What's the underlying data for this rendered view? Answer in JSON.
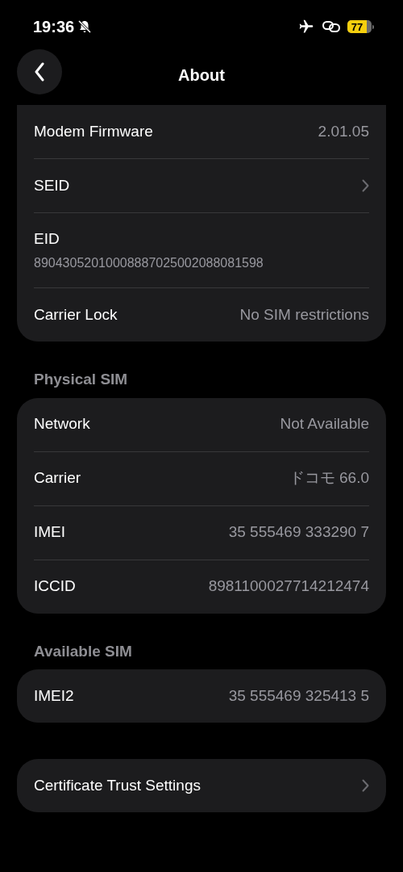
{
  "status_bar": {
    "time": "19:36",
    "battery": "77"
  },
  "nav": {
    "title": "About"
  },
  "sections": [
    {
      "rows": [
        {
          "kind": "value",
          "label": "Modem Firmware",
          "value": "2.01.05"
        },
        {
          "kind": "link",
          "label": "SEID"
        },
        {
          "kind": "stacked",
          "label": "EID",
          "value": "89043052010008887025002088081598"
        },
        {
          "kind": "value",
          "label": "Carrier Lock",
          "value": "No SIM restrictions"
        }
      ]
    },
    {
      "header": "Physical SIM",
      "rows": [
        {
          "kind": "value",
          "label": "Network",
          "value": "Not Available"
        },
        {
          "kind": "value",
          "label": "Carrier",
          "value": "ドコモ 66.0"
        },
        {
          "kind": "value",
          "label": "IMEI",
          "value": "35 555469 333290 7"
        },
        {
          "kind": "value",
          "label": "ICCID",
          "value": "8981100027714212474"
        }
      ]
    },
    {
      "header": "Available SIM",
      "rows": [
        {
          "kind": "value",
          "label": "IMEI2",
          "value": "35 555469 325413 5"
        }
      ]
    },
    {
      "rows": [
        {
          "kind": "link",
          "label": "Certificate Trust Settings"
        }
      ]
    }
  ]
}
